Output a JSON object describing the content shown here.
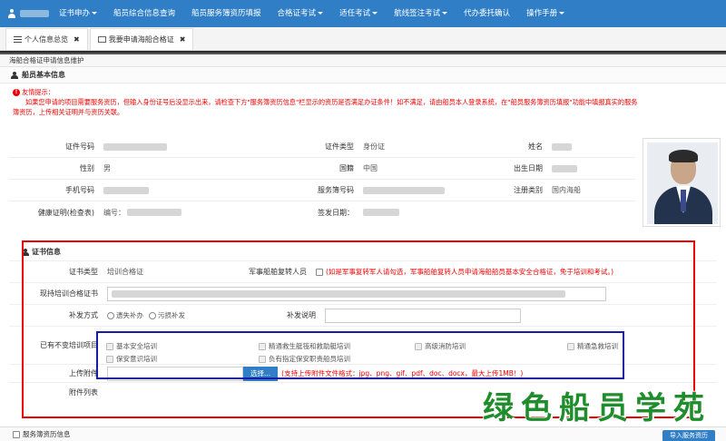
{
  "nav": {
    "menus": [
      {
        "label": "证书申办",
        "caret": true
      },
      {
        "label": "船员综合信息查询",
        "caret": false
      },
      {
        "label": "船员服务簿资历填报",
        "caret": false
      },
      {
        "label": "合格证考试",
        "caret": true
      },
      {
        "label": "适任考试",
        "caret": true
      },
      {
        "label": "航线签注考试",
        "caret": true
      },
      {
        "label": "代办委托确认",
        "caret": false
      },
      {
        "label": "操作手册",
        "caret": true
      }
    ]
  },
  "tabs": [
    {
      "label": "个人信息总览",
      "close": "✖"
    },
    {
      "label": "我要申请海船合格证",
      "close": "✖"
    }
  ],
  "breadcrumb": "海船合格证申请信息维护",
  "basic": {
    "section_title": "船员基本信息",
    "notice_title": "友情提示：",
    "notice_line1": "如果您申请的项目需要服务资历，但输入身份证号后没显示出来，请检查下方\"服务簿资历信息\"栏显示的资历是否满足办证条件！如不满足，请由船员本人登录系统，在\"船员服务簿资历填报\"功能中填报真实的服务",
    "notice_line2": "簿资历，上传相关证明并与资历关联。",
    "labels": {
      "cert_no": "证件号码",
      "cert_type": "证件类型",
      "name": "姓名",
      "gender": "性别",
      "nationality": "国籍",
      "birthdate": "出生日期",
      "phone": "手机号码",
      "service_book_no": "服务簿号码",
      "reg_type": "注册类别",
      "health_cert": "健康证明(检查表)",
      "issue_date": "签发日期："
    },
    "values": {
      "cert_type": "身份证",
      "gender": "男",
      "nationality": "中国",
      "reg_type": "国内海船",
      "health_no_prefix": "编号："
    }
  },
  "cert": {
    "section_title": "证书信息",
    "labels": {
      "cert_type": "证书类型",
      "military": "军事船舶复转人员",
      "current_cert": "现持培训合格证书",
      "reissue_method": "补发方式",
      "reissue_note": "补发说明",
      "exempt_items": "已有不变培训项目",
      "upload": "上传附件",
      "attachment_list": "附件列表"
    },
    "values": {
      "cert_type": "培训合格证",
      "military_note": "(如是军事复转军人请勾选，军事船舶复转人员申请海船船员基本安全合格证，免于培训和考试。)",
      "reissue_options": [
        "遗失补办",
        "污损补发"
      ],
      "upload_button": "选择...",
      "upload_note": "(支持上传附件文件格式：jpg、png、gif、pdf、doc、docx，最大上传1MB！)"
    },
    "courses": [
      "基本安全培训",
      "精通救生艇筏和救助艇培训",
      "高级消防培训",
      "精通急救培训",
      "保安意识培训",
      "负有指定保安职责船员培训"
    ]
  },
  "bottom": {
    "section_title": "服务簿资历信息",
    "button": "导入服务资历"
  },
  "watermark": "绿色船员学苑"
}
